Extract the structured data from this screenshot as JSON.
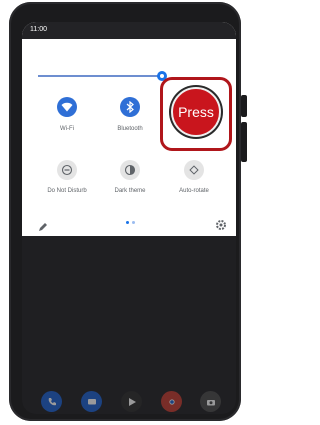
{
  "status_bar": {
    "time": "11:00"
  },
  "brightness": {
    "level": 0.95
  },
  "tiles": [
    {
      "label": "Wi-Fi",
      "icon": "wifi-icon",
      "state": "on"
    },
    {
      "label": "Bluetooth",
      "icon": "bluetooth-icon",
      "state": "on"
    },
    {
      "label": "Do Not Disturb",
      "icon": "do-not-disturb-icon",
      "state": "off"
    },
    {
      "label": "Dark theme",
      "icon": "dark-theme-icon",
      "state": "off"
    },
    {
      "label": "Auto-rotate",
      "icon": "auto-rotate-icon",
      "state": "off"
    }
  ],
  "overlay": {
    "press_label": "Press"
  },
  "pager": {
    "pages": 2,
    "current": 1
  },
  "dock": {
    "apps": [
      "phone-icon",
      "messages-icon",
      "play-store-icon",
      "chrome-icon",
      "camera-icon"
    ]
  },
  "colors": {
    "accent": "#1a73e8",
    "tile_on": "#2f6fd6",
    "press_red": "#c9151d",
    "frame_red": "#b0161b"
  }
}
